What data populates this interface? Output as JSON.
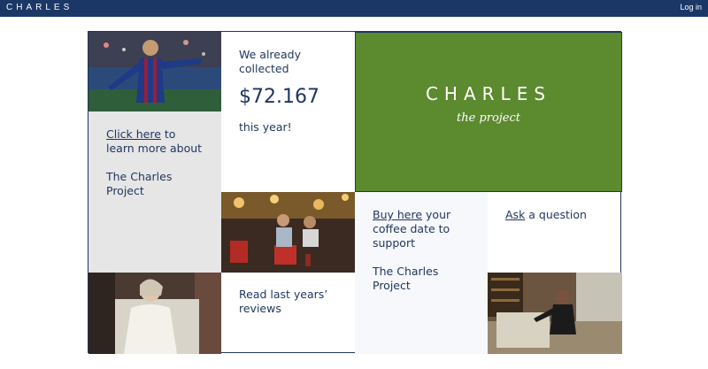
{
  "nav": {
    "brand": "CHARLES",
    "login": "Log in"
  },
  "tiles": {
    "collected": {
      "line1": "We already collected",
      "amount": "$72.167",
      "line2": "this year!"
    },
    "learn": {
      "link": "Click here",
      "text": " to learn more about",
      "project": "The Charles Project"
    },
    "logo": {
      "title": "CHARLES",
      "subtitle": "the project"
    },
    "coffee": {
      "link": "Buy here",
      "text": " your coffee date to support",
      "project": "The Charles Project"
    },
    "ask": {
      "link": "Ask",
      "text": " a question"
    },
    "reviews": {
      "text": "Read last years’ reviews"
    }
  },
  "colors": {
    "navy": "#1a3766",
    "green": "#5c8a2e",
    "grey": "#e6e6e6",
    "pale": "#f7f8fc"
  },
  "photos": [
    "footballer-photo",
    "cafe-photo",
    "woman-chair-photo",
    "woman-library-photo"
  ]
}
